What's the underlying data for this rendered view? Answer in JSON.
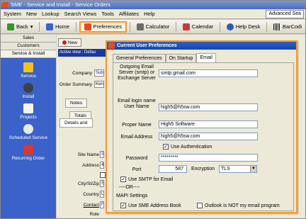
{
  "window": {
    "title": "SME - Service and Install - Service Orders"
  },
  "menu": {
    "items": [
      "System",
      "New",
      "Lookup",
      "Search Views",
      "Tools",
      "Affiliates",
      "Help"
    ],
    "advanced_search": "Advanced Sea"
  },
  "toolbar": {
    "back": "Back",
    "home": "Home",
    "preferences": "Preferences",
    "calculator": "Calculator",
    "calendar": "Calendar",
    "help_desk": "Help Desk",
    "barcode": "BarCodi"
  },
  "sidebar": {
    "buttons": [
      "Sales",
      "Customers",
      "Service & Install"
    ],
    "items": [
      {
        "label": "Service",
        "icon": "warning-icon"
      },
      {
        "label": "Install",
        "icon": "tools-icon"
      },
      {
        "label": "Projects",
        "icon": "document-icon"
      },
      {
        "label": "Scheduled Service",
        "icon": "clock-icon"
      },
      {
        "label": "Recurring Order",
        "icon": "recurring-icon"
      }
    ]
  },
  "main": {
    "new_label": "New",
    "active_view": "Active view : Defau",
    "company_label": "Company",
    "company_value": "Subi",
    "order_summary_label": "Order Summary",
    "order_summary_value": "Kenc",
    "notes_tab": "Notes",
    "totals_tab": "Totals",
    "details_tab": "Details and",
    "site_name_label": "Site Name",
    "site_name_value": "S",
    "address_label": "Address",
    "address_value": "4",
    "city_label": "City/St/Zip",
    "city_value": "S",
    "country_label": "Country",
    "country_value": "U",
    "contact_label": "Contact",
    "contact_value": "F",
    "role_label": "Role"
  },
  "dialog": {
    "title": "Current User Preferences",
    "tabs": [
      "General Preferences",
      "On Startup",
      "Email"
    ],
    "active_tab": "Email",
    "outgoing_label": "Outgoing Email Server (smtp) or Exchange Server",
    "outgoing_value": "smtp.gmail.com",
    "login_label": "Email login name User Name",
    "login_value": "high5@h5sw.com",
    "proper_name_label": "Proper Name",
    "proper_name_value": "High5 Software",
    "email_address_label": "Email Address",
    "email_address_value": "high5@h5sw.com",
    "use_auth_label": "Use Authentication",
    "use_auth_checked": true,
    "password_label": "Password",
    "password_value": "*********",
    "port_label": "Port",
    "port_value": "587",
    "encryption_label": "Encryption",
    "encryption_value": "TLS",
    "use_smtp_label": "Use SMTP for Email",
    "use_smtp_checked": true,
    "or_text": "----OR----",
    "mapi_label": "MAPI Settings",
    "use_sme_label": "Use SME Address Book",
    "use_sme_checked": true,
    "outlook_label": "Outlook is NOT my email program",
    "outlook_checked": false
  },
  "colors": {
    "accent_highlight": "#f39a2a",
    "sidebar_blue": "#3a62c8",
    "titlebar_blue": "#4a6cb8"
  }
}
